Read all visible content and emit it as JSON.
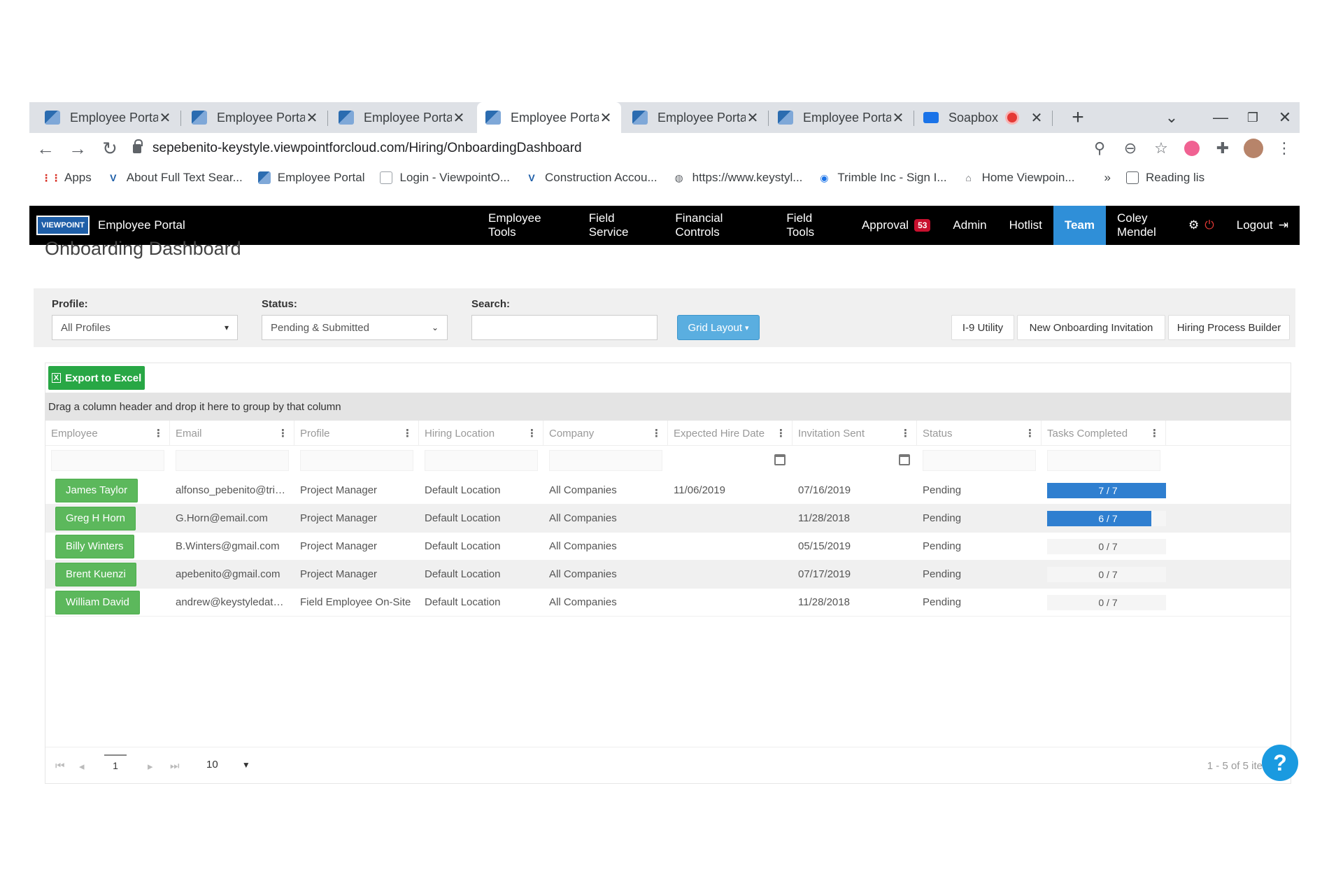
{
  "browser": {
    "tabs": [
      {
        "title": "Employee Porta"
      },
      {
        "title": "Employee Porta"
      },
      {
        "title": "Employee Porta"
      },
      {
        "title": "Employee Porta"
      },
      {
        "title": "Employee Porta"
      },
      {
        "title": "Employee Porta"
      },
      {
        "title": "Soapbox"
      }
    ],
    "url": "sepebenito-keystyle.viewpointforcloud.com/Hiring/OnboardingDashboard",
    "bookmarks": [
      {
        "label": "Apps",
        "icon": "apps-grid-icon"
      },
      {
        "label": "About Full Text Sear...",
        "icon": "v-logo-icon"
      },
      {
        "label": "Employee Portal",
        "icon": "portal-icon"
      },
      {
        "label": "Login - ViewpointO...",
        "icon": "doc-icon"
      },
      {
        "label": "Construction Accou...",
        "icon": "v-logo-icon"
      },
      {
        "label": "https://www.keystyl...",
        "icon": "globe-icon"
      },
      {
        "label": "Trimble Inc - Sign I...",
        "icon": "trimble-icon"
      },
      {
        "label": "Home Viewpoin...",
        "icon": "home-icon"
      }
    ],
    "reading_list": "Reading lis"
  },
  "app": {
    "logo_text": "VIEWPOINT",
    "title": "Employee Portal",
    "menu": [
      "Employee Tools",
      "Field Service",
      "Financial Controls",
      "Field Tools",
      "Approval",
      "Admin",
      "Hotlist",
      "Team"
    ],
    "approval_count": "53",
    "user": "Coley Mendel",
    "logout": "Logout"
  },
  "page": {
    "title": "Onboarding Dashboard"
  },
  "filters": {
    "profile_label": "Profile:",
    "profile_value": "All Profiles",
    "status_label": "Status:",
    "status_value": "Pending & Submitted",
    "search_label": "Search:",
    "search_value": "",
    "grid_layout": "Grid Layout",
    "i9": "I-9 Utility",
    "new_invite": "New Onboarding Invitation",
    "builder": "Hiring Process Builder"
  },
  "grid": {
    "export": "Export to Excel",
    "group_hint": "Drag a column header and drop it here to group by that column",
    "columns": [
      "Employee",
      "Email",
      "Profile",
      "Hiring Location",
      "Company",
      "Expected Hire Date",
      "Invitation Sent",
      "Status",
      "Tasks Completed"
    ],
    "rows": [
      {
        "employee": "James Taylor",
        "email": "alfonso_pebenito@trim...",
        "profile": "Project Manager",
        "location": "Default Location",
        "company": "All Companies",
        "hire_date": "11/06/2019",
        "sent": "07/16/2019",
        "status": "Pending",
        "tasks": "7 / 7",
        "tasks_fraction": 1.0
      },
      {
        "employee": "Greg H Horn",
        "email": "G.Horn@email.com",
        "profile": "Project Manager",
        "location": "Default Location",
        "company": "All Companies",
        "hire_date": "",
        "sent": "11/28/2018",
        "status": "Pending",
        "tasks": "6 / 7",
        "tasks_fraction": 0.857
      },
      {
        "employee": "Billy Winters",
        "email": "B.Winters@gmail.com",
        "profile": "Project Manager",
        "location": "Default Location",
        "company": "All Companies",
        "hire_date": "",
        "sent": "05/15/2019",
        "status": "Pending",
        "tasks": "0 / 7",
        "tasks_fraction": 0
      },
      {
        "employee": "Brent Kuenzi",
        "email": "apebenito@gmail.com",
        "profile": "Project Manager",
        "location": "Default Location",
        "company": "All Companies",
        "hire_date": "",
        "sent": "07/17/2019",
        "status": "Pending",
        "tasks": "0 / 7",
        "tasks_fraction": 0
      },
      {
        "employee": "William David",
        "email": "andrew@keystyledatas...",
        "profile": "Field Employee On-Site",
        "location": "Default Location",
        "company": "All Companies",
        "hire_date": "",
        "sent": "11/28/2018",
        "status": "Pending",
        "tasks": "0 / 7",
        "tasks_fraction": 0
      }
    ],
    "page": "1",
    "page_size": "10",
    "info": "1 - 5 of 5 ite"
  },
  "colors": {
    "accent": "#2f8fd8",
    "employee_button": "#5cb85c",
    "export_button": "#28a745",
    "progress_fill": "#2f7fd0",
    "approval_badge": "#c8102e"
  }
}
